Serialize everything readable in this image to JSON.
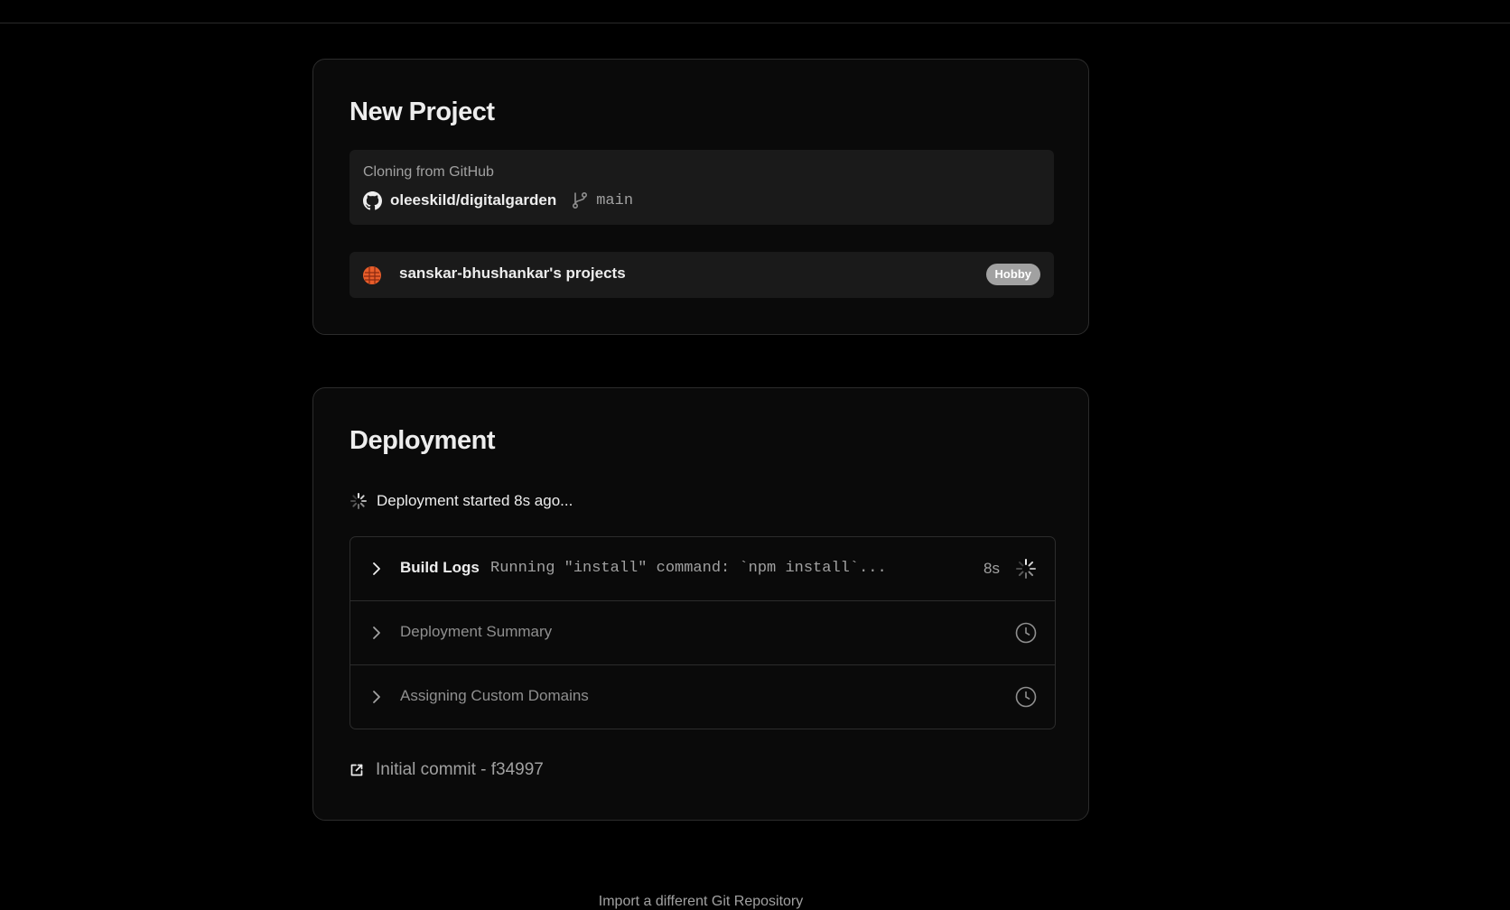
{
  "new_project": {
    "title": "New Project",
    "clone_label": "Cloning from GitHub",
    "repo": "oleeskild/digitalgarden",
    "branch": "main",
    "team_name": "sanskar-bhushankar's projects",
    "plan_badge": "Hobby"
  },
  "deployment": {
    "title": "Deployment",
    "status": "Deployment started 8s ago...",
    "steps": [
      {
        "title": "Build Logs",
        "log": "Running \"install\" command: `npm install`...",
        "time": "8s",
        "state": "running"
      },
      {
        "title": "Deployment Summary",
        "state": "pending"
      },
      {
        "title": "Assigning Custom Domains",
        "state": "pending"
      }
    ],
    "commit": "Initial commit - f34997"
  },
  "footer": {
    "import_link": "Import a different Git Repository"
  },
  "colors": {
    "background": "#000000",
    "card": "#0a0a0a",
    "panel": "#1a1a1a",
    "avatar": "#e85d2a"
  }
}
